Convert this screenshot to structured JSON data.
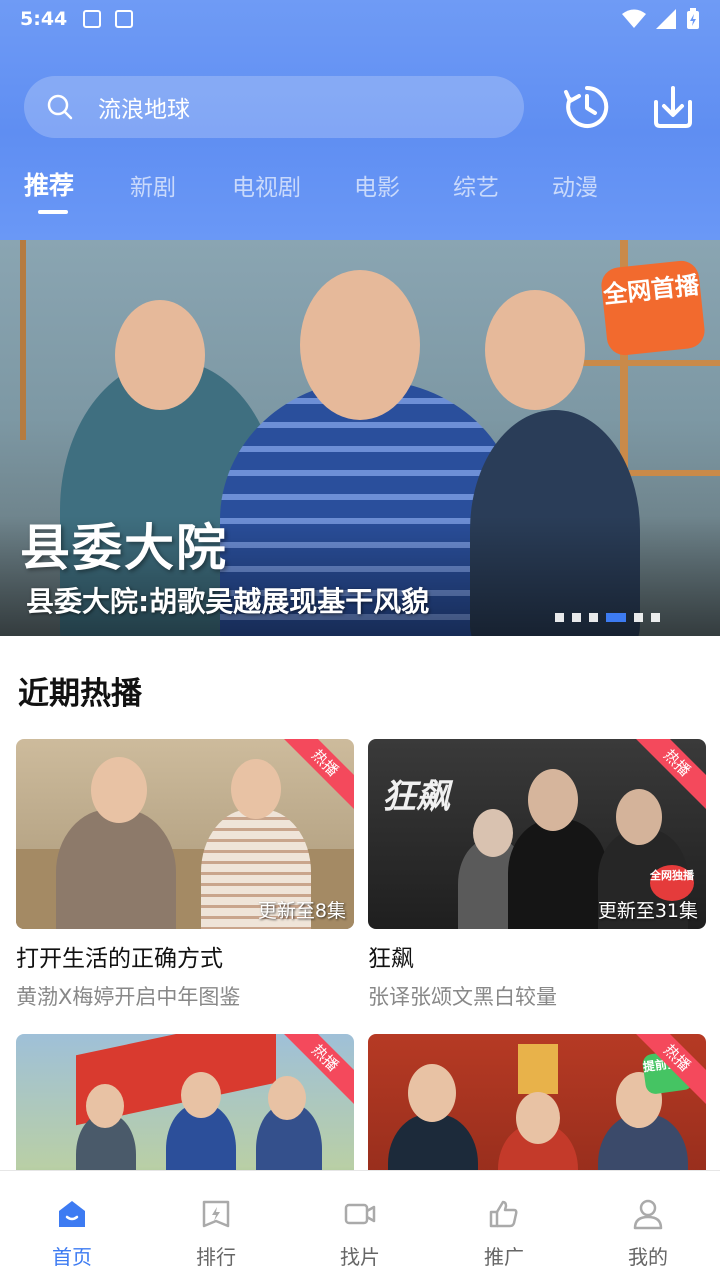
{
  "status_bar": {
    "time": "5:44"
  },
  "search": {
    "text": "流浪地球"
  },
  "tabs": [
    {
      "label": "推荐"
    },
    {
      "label": "新剧"
    },
    {
      "label": "电视剧"
    },
    {
      "label": "电影"
    },
    {
      "label": "综艺"
    },
    {
      "label": "动漫"
    }
  ],
  "banner": {
    "big_title": "县委大院",
    "badge": "全网首播",
    "caption": "县委大院:胡歌吴越展现基干风貌",
    "dot_count": 6,
    "active_dot": 4
  },
  "section": {
    "title": "近期热播"
  },
  "cards": [
    {
      "tag": "热播",
      "episode": "更新至8集",
      "title": "打开生活的正确方式",
      "subtitle": "黄渤X梅婷开启中年图鉴"
    },
    {
      "tag": "热播",
      "episode": "更新至31集",
      "title": "狂飙",
      "subtitle": "张译张颂文黑白较量",
      "art_text": "狂飙",
      "badge": "全网独播"
    },
    {
      "tag": "热播"
    },
    {
      "tag": "热播",
      "badge": "提前预约"
    }
  ],
  "bottom_nav": [
    {
      "label": "首页"
    },
    {
      "label": "排行"
    },
    {
      "label": "找片"
    },
    {
      "label": "推广"
    },
    {
      "label": "我的"
    }
  ],
  "colors": {
    "accent": "#3d7bf2",
    "header": "#6a98f6",
    "hot": "#f4495c"
  }
}
